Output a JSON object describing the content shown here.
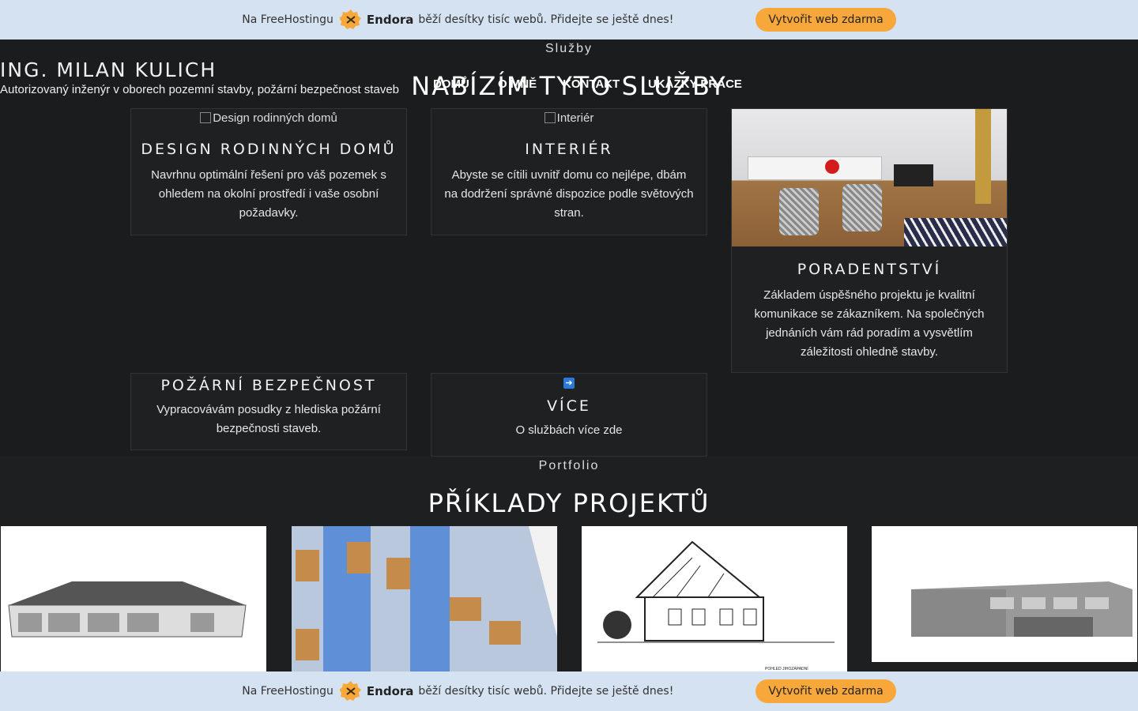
{
  "promo": {
    "prefix": "Na FreeHostingu",
    "brand": "Endora",
    "suffix": "běží desítky tisíc webů. Přidejte se ještě dnes!",
    "cta": "Vytvořit web zdarma"
  },
  "site": {
    "title": "ING. MILAN KULICH",
    "subtitle": "Autorizovaný inženýr v oborech pozemní stavby, požární bezpečnost staveb"
  },
  "nav": [
    "DOMŮ",
    "O MNĚ",
    "KONTAKT",
    "UKÁZKY PRÁCE"
  ],
  "services": {
    "label": "Služby",
    "heading": "NABÍZÍM TYTO SLUŽBY",
    "cards": [
      {
        "alt": "Design rodinných domů",
        "title": "DESIGN RODINNÝCH DOMŮ",
        "text": "Navrhnu optimální řešení pro váš pozemek s ohledem na okolní prostředí i vaše osobní požadavky."
      },
      {
        "alt": "Interiér",
        "title": "INTERIÉR",
        "text": "Abyste se cítili uvnitř domu co nejlépe, dbám na dodržení správné dispozice podle světových stran."
      },
      {
        "title": "PORADENTSTVÍ",
        "text": "Základem úspěšného projektu je kvalitní komunikace se zákazníkem. Na společných jednáních vám rád poradím a vysvětlím záležitosti ohledně stavby."
      },
      {
        "title": "POŽÁRNÍ BEZPEČNOST",
        "text": "Vypracovávám posudky z hlediska požární bezpečnosti staveb."
      },
      {
        "title": "VÍCE",
        "text": "O službách více zde"
      }
    ]
  },
  "portfolio": {
    "label": "Portfolio",
    "heading": "PŘÍKLADY PROJEKTŮ",
    "drawing_caption": "POHLED JIHOZÁPADNÍ"
  },
  "colors": {
    "promo_bg": "#d5e2f1",
    "cta": "#f8a73b",
    "page_bg": "#1b1c1d"
  }
}
